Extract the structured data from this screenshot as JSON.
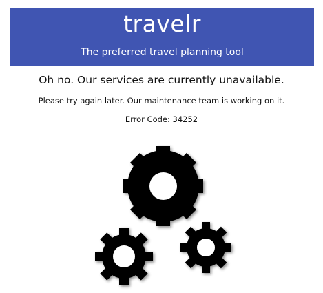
{
  "header": {
    "brand": "travelr",
    "tagline": "The preferred travel planning tool"
  },
  "message": {
    "title": "Oh no. Our services are currently unavailable.",
    "detail": "Please try again later. Our maintenance team is working on it.",
    "error_code": "Error Code: 34252"
  },
  "illustration": {
    "icon": "gears-icon"
  },
  "colors": {
    "banner": "#4055b2",
    "banner_text": "#ffffff",
    "body_text": "#111111",
    "gear": "#000000",
    "gear_hub": "#ffffff"
  }
}
